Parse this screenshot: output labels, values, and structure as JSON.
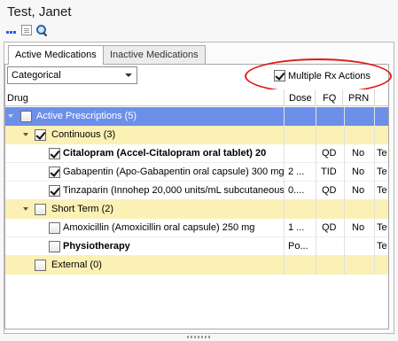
{
  "patient": {
    "name": "Test, Janet"
  },
  "toolbar": {
    "icons": [
      "more-icon",
      "document-icon",
      "search-icon"
    ]
  },
  "tabs": [
    "Active Medications",
    "Inactive Medications"
  ],
  "view_select": {
    "value": "Categorical"
  },
  "multiple_rx": {
    "label": "Multiple Rx Actions",
    "checked": true
  },
  "columns": {
    "drug": "Drug",
    "dose": "Dose",
    "fq": "FQ",
    "prn": "PRN"
  },
  "rows": {
    "active": {
      "label": "Active Prescriptions (5)"
    },
    "continuous": {
      "label": "Continuous (3)"
    },
    "citalopram": {
      "drug": "Citalopram (Accel-Citalopram oral tablet) 20",
      "dose": "",
      "fq": "QD",
      "prn": "No",
      "extra": "Te"
    },
    "gabapentin": {
      "drug": "Gabapentin (Apo-Gabapentin oral capsule) 300 mg",
      "dose": "2 ...",
      "fq": "TID",
      "prn": "No",
      "extra": "Te"
    },
    "tinzaparin": {
      "drug": "Tinzaparin (Innohep 20,000 units/mL subcutaneous",
      "dose": "0....",
      "fq": "QD",
      "prn": "No",
      "extra": "Te"
    },
    "short_term": {
      "label": "Short Term (2)"
    },
    "amoxicillin": {
      "drug": "Amoxicillin (Amoxicillin oral capsule) 250 mg",
      "dose": "1 ...",
      "fq": "QD",
      "prn": "No",
      "extra": "Te"
    },
    "physio": {
      "drug": "Physiotherapy",
      "dose": "Po...",
      "fq": "",
      "prn": "",
      "extra": "Te"
    },
    "external": {
      "label": "External (0)"
    }
  }
}
